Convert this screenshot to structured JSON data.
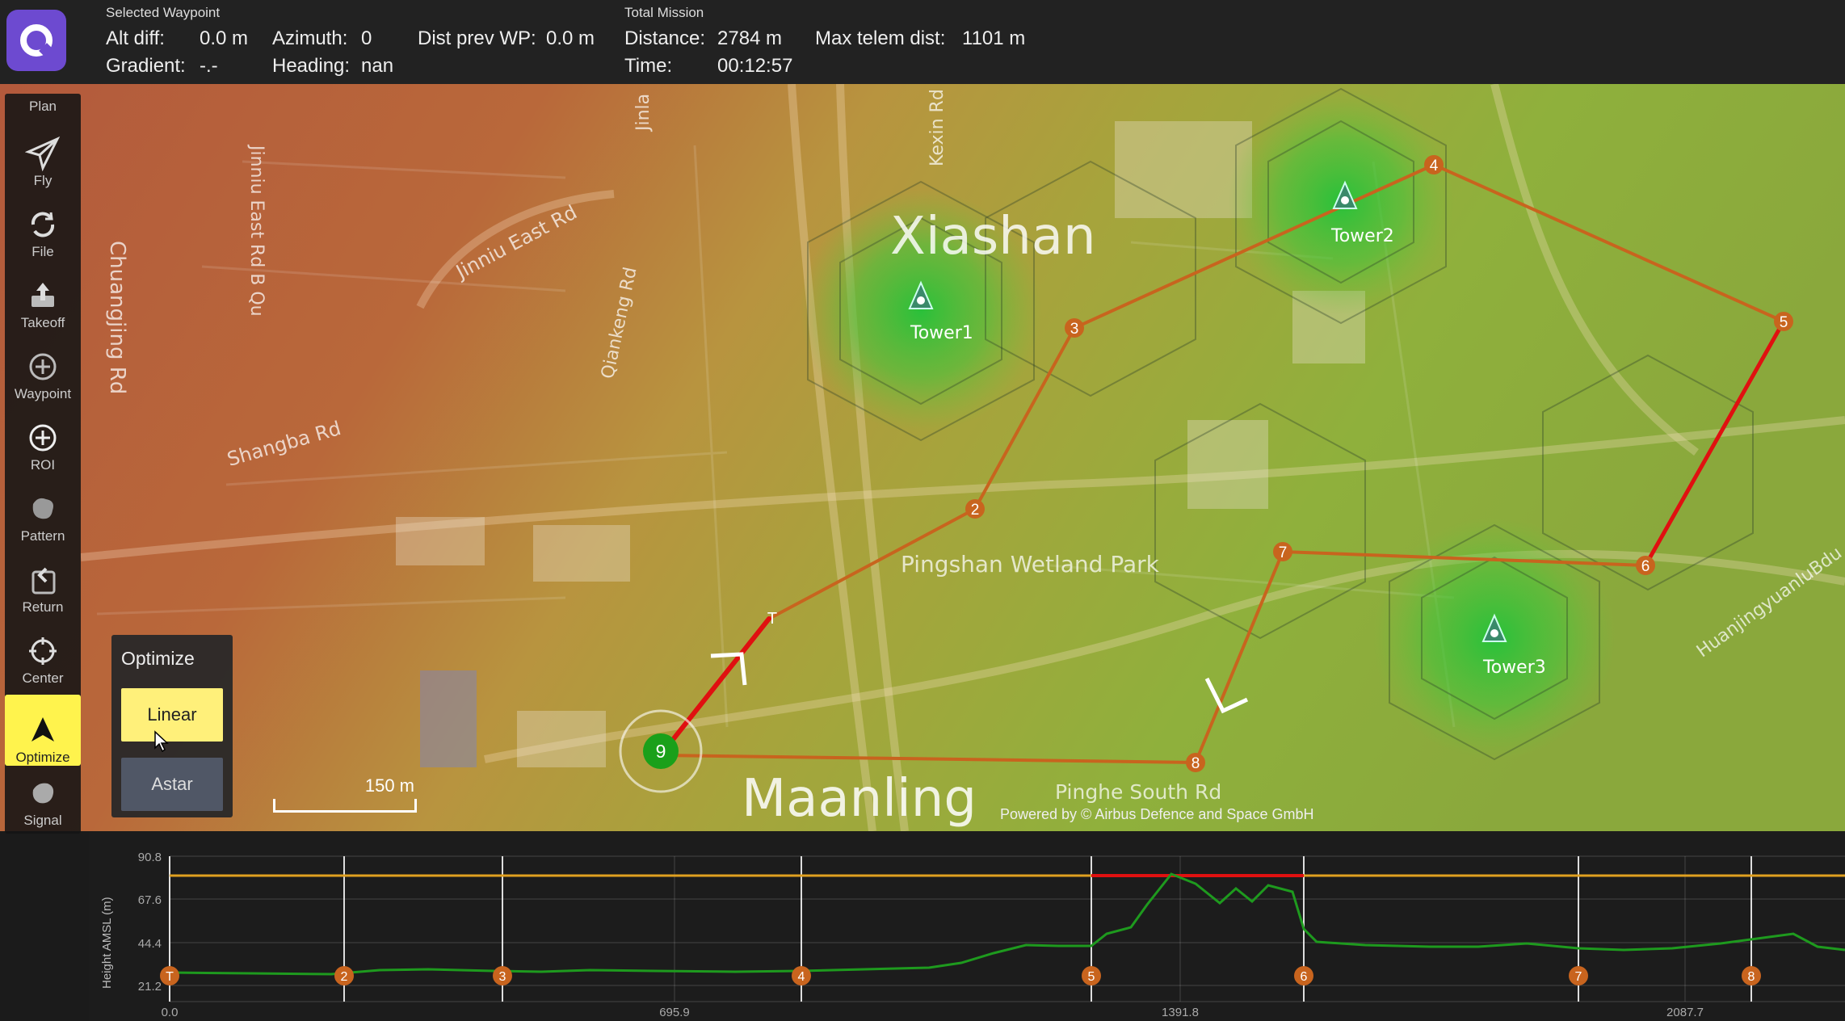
{
  "topbar": {
    "selected_waypoint_title": "Selected Waypoint",
    "alt_diff_label": "Alt diff:",
    "alt_diff_value": "0.0 m",
    "azimuth_label": "Azimuth:",
    "azimuth_value": "0",
    "dist_prev_label": "Dist prev WP:",
    "dist_prev_value": "0.0 m",
    "gradient_label": "Gradient:",
    "gradient_value": "-.-",
    "heading_label": "Heading:",
    "heading_value": "nan",
    "total_mission_title": "Total Mission",
    "distance_label": "Distance:",
    "distance_value": "2784 m",
    "max_telem_label": "Max telem dist:",
    "max_telem_value": "1101 m",
    "time_label": "Time:",
    "time_value": "00:12:57"
  },
  "toolbar": {
    "plan_label": "Plan",
    "items": [
      {
        "label": "Fly",
        "icon": "paper-plane-icon"
      },
      {
        "label": "File",
        "icon": "sync-icon"
      },
      {
        "label": "Takeoff",
        "icon": "takeoff-icon"
      },
      {
        "label": "Waypoint",
        "icon": "plus-circle-icon"
      },
      {
        "label": "ROI",
        "icon": "plus-circle-icon"
      },
      {
        "label": "Pattern",
        "icon": "pattern-icon"
      },
      {
        "label": "Return",
        "icon": "return-icon"
      },
      {
        "label": "Center",
        "icon": "crosshair-icon"
      },
      {
        "label": "Optimize",
        "icon": "arrow-up-icon"
      },
      {
        "label": "Signal",
        "icon": "signal-icon"
      }
    ],
    "active": "Optimize"
  },
  "optimize_menu": {
    "title": "Optimize",
    "options": [
      "Linear",
      "Astar"
    ],
    "selected": "Linear"
  },
  "map": {
    "labels": {
      "xiashan": "Xiashan",
      "maanling": "Maanling",
      "pingshan": "Pingshan Wetland Park",
      "pinghe": "Pinghe South Rd",
      "jinniu_east": "Jinniu East Rd",
      "jinniu_east_b": "Jinniu East Rd B Qu",
      "chuangjing": "Chuangjing Rd",
      "shangba": "Shangba Rd",
      "qiankeng": "Qiankeng Rd",
      "jinla": "Jinla",
      "kexin": "Kexin Rd",
      "huanjing": "HuanjingyuanluBdu"
    },
    "towers": [
      "Tower1",
      "Tower2",
      "Tower3"
    ],
    "waypoints": [
      "T",
      "2",
      "3",
      "4",
      "5",
      "6",
      "7",
      "8",
      "9"
    ],
    "scale_label": "150 m",
    "attribution": "Powered by © Airbus Defence and Space GmbH",
    "colors": {
      "route": "#c8641e",
      "route_bad": "#e01010",
      "home": "#1aa01a"
    }
  },
  "elevation_chart": {
    "ylabel": "Height AMSL (m)",
    "y_ticks": [
      "90.8",
      "67.6",
      "44.4",
      "21.2"
    ],
    "x_ticks": [
      "0.0",
      "695.9",
      "1391.8",
      "2087.7"
    ],
    "waypoint_markers": [
      "T",
      "2",
      "3",
      "4",
      "5",
      "6",
      "7",
      "8"
    ]
  }
}
